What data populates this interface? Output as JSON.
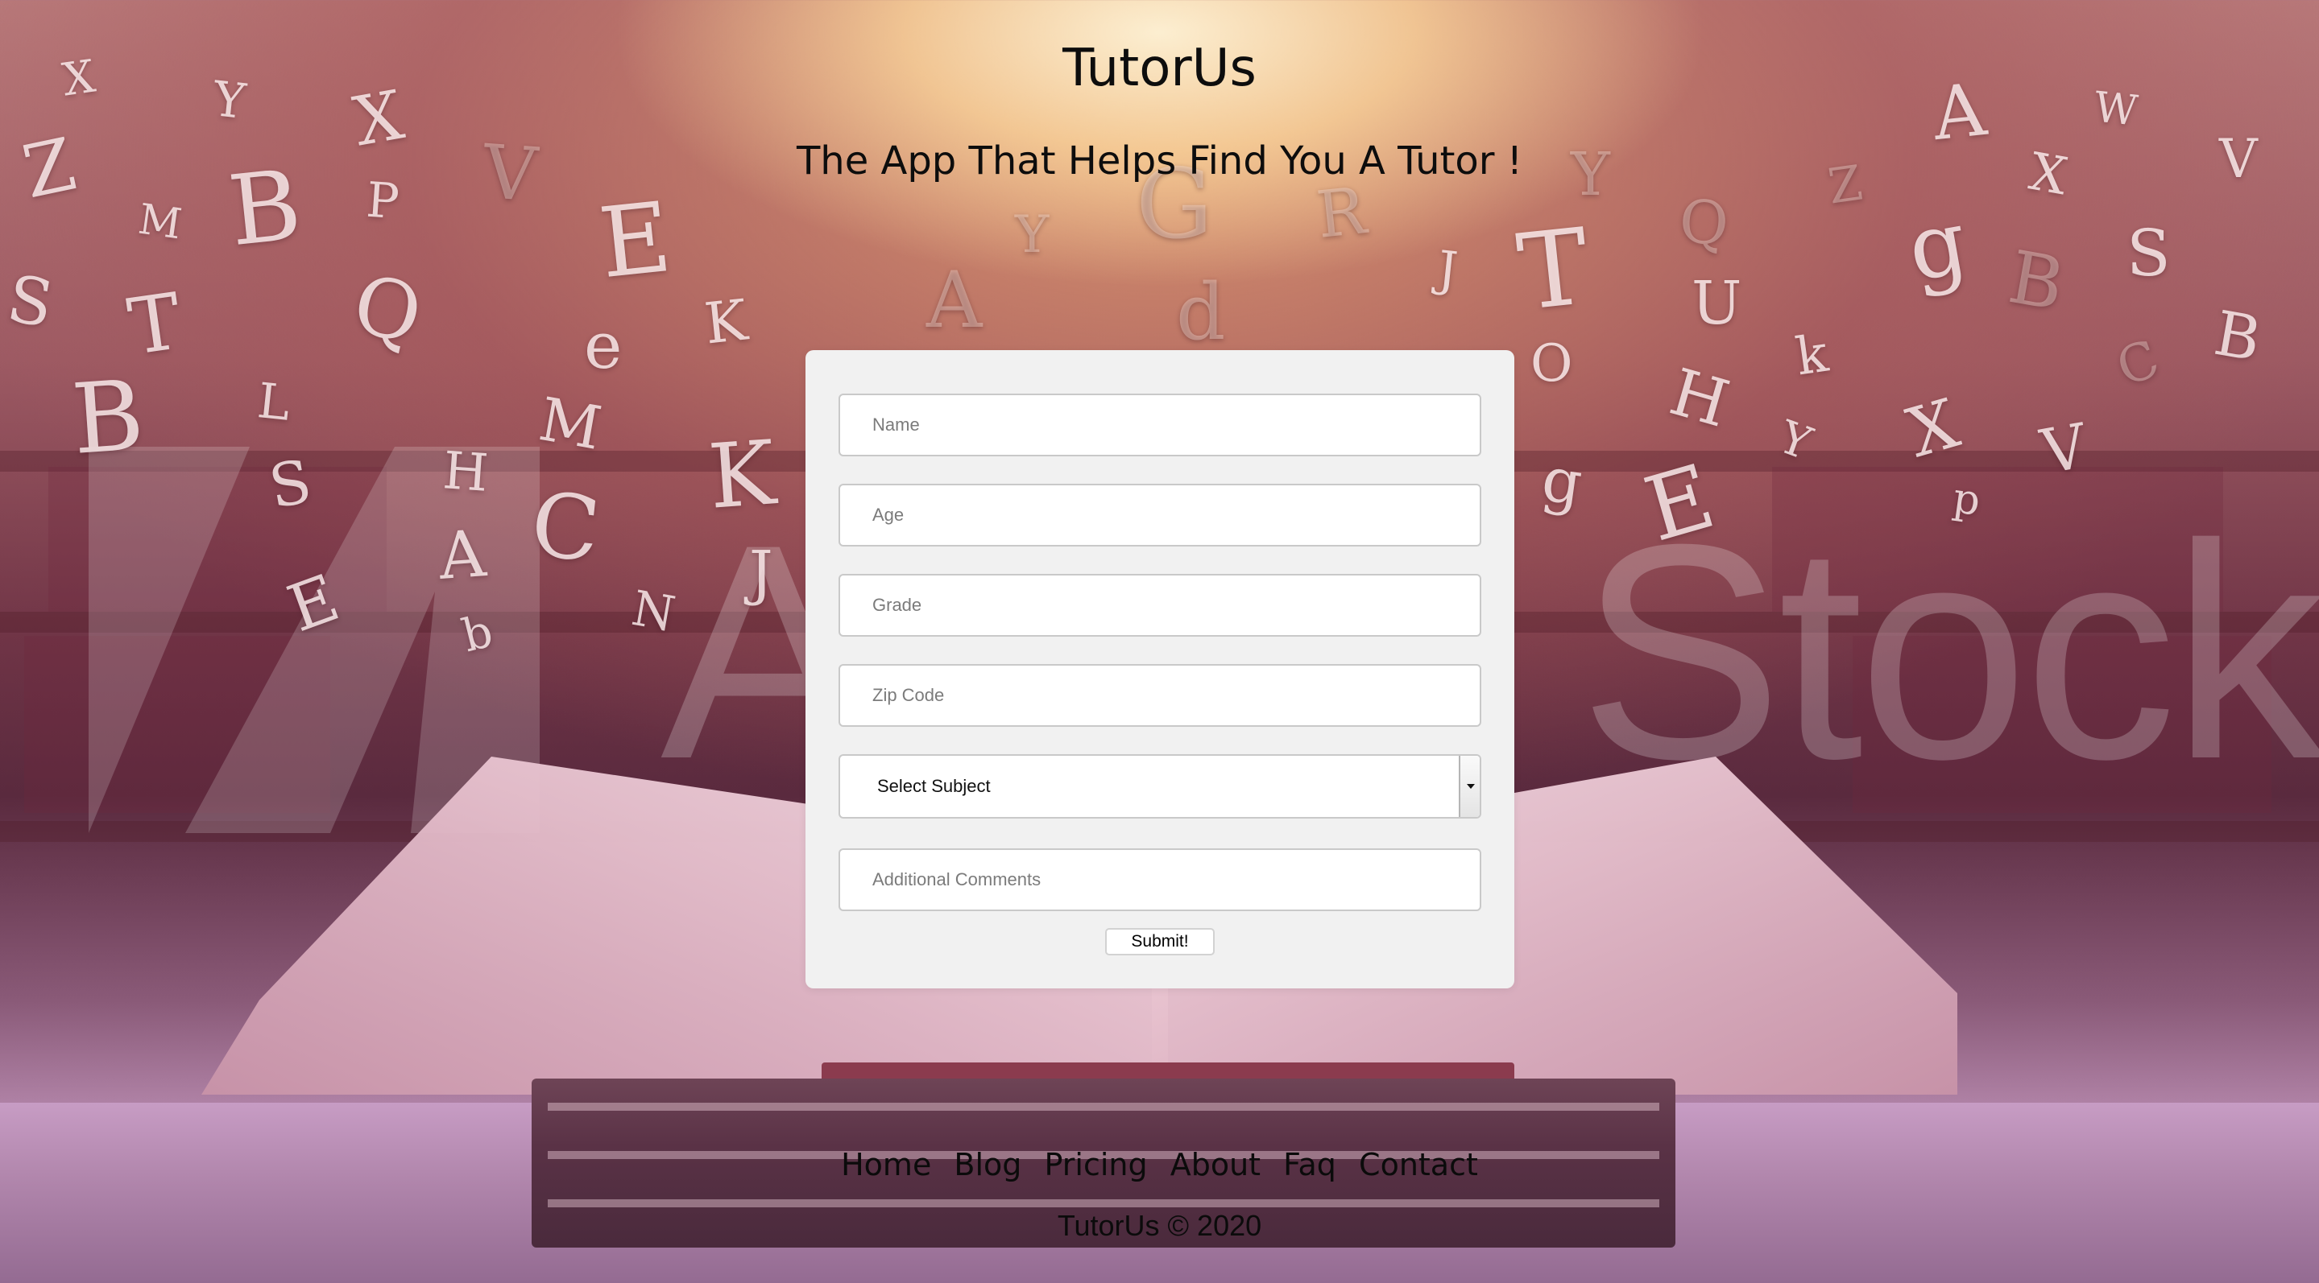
{
  "header": {
    "title": "TutorUs",
    "tagline": "The App That Helps Find You A Tutor !"
  },
  "form": {
    "name_placeholder": "Name",
    "age_placeholder": "Age",
    "grade_placeholder": "Grade",
    "zip_placeholder": "Zip Code",
    "subject_selected": "Select Subject",
    "comments_placeholder": "Additional Comments",
    "submit_label": "Submit!"
  },
  "footer": {
    "nav": [
      "Home",
      "Blog",
      "Pricing",
      "About",
      "Faq",
      "Contact"
    ],
    "copyright": "TutorUs © 2020"
  },
  "background": {
    "watermark_text": "Stock",
    "watermark_letter": "A",
    "letters": [
      "X",
      "Y",
      "X",
      "Z",
      "M",
      "B",
      "P",
      "V",
      "E",
      "S",
      "T",
      "Q",
      "e",
      "K",
      "B",
      "L",
      "S",
      "H",
      "A",
      "M",
      "C",
      "K",
      "E",
      "b",
      "N",
      "J",
      "A",
      "d",
      "J",
      "T",
      "Y",
      "Q",
      "g",
      "S",
      "B",
      "U",
      "H",
      "k",
      "C",
      "B",
      "X",
      "Y",
      "V",
      "p",
      "E",
      "O",
      "g",
      "A",
      "W",
      "V",
      "X",
      "Z",
      "Y",
      "R",
      "G"
    ]
  },
  "colors": {
    "card_bg": "#f1f1f1",
    "text": "#0d0d0d"
  }
}
